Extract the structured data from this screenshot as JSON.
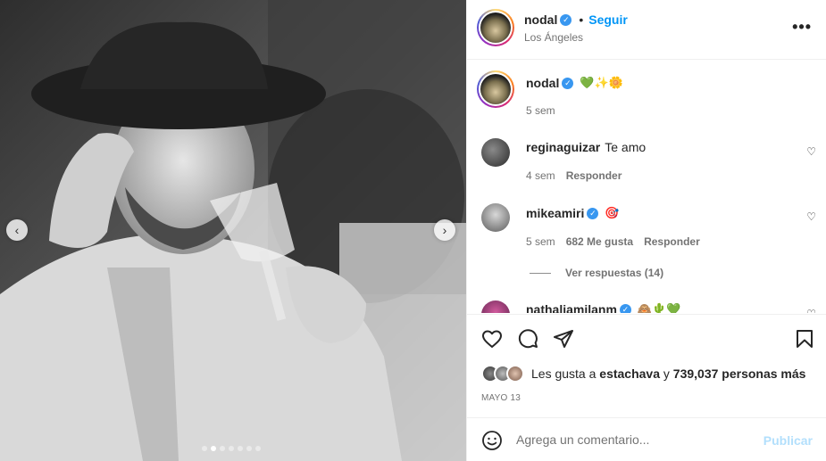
{
  "post": {
    "author": "nodal",
    "follow_label": "Seguir",
    "separator": "•",
    "location": "Los Ángeles",
    "more_label": "•••",
    "caption_emojis": "💚✨🌼",
    "caption_time": "5 sem"
  },
  "carousel": {
    "prev_label": "‹",
    "next_label": "›",
    "slide_count": 7,
    "active_slide": 2
  },
  "comments": [
    {
      "user": "reginaguizar",
      "text": "Te amo",
      "time": "4 sem",
      "likes": "",
      "reply_label": "Responder",
      "verified": false
    },
    {
      "user": "mikeamiri",
      "text": "🎯",
      "time": "5 sem",
      "likes": "682 Me gusta",
      "reply_label": "Responder",
      "verified": true
    },
    {
      "user": "nathaliamilanm",
      "text": "🙈🌵💚",
      "verified": true
    }
  ],
  "view_replies_label": "Ver respuestas (14)",
  "likes": {
    "prefix": "Les gusta a",
    "liker": "estachava",
    "joiner": "y",
    "rest": "739,037 personas más"
  },
  "date": "MAYO 13",
  "add_comment": {
    "placeholder": "Agrega un comentario...",
    "publish_label": "Publicar"
  },
  "colors": {
    "link_blue": "#0095f6",
    "publish_disabled": "#b2dffc",
    "verified_blue": "#3897f0",
    "muted_text": "#737373"
  },
  "icons": [
    "heart-icon",
    "comment-icon",
    "share-icon",
    "bookmark-icon",
    "emoji-icon",
    "verified-icon",
    "more-icon"
  ]
}
